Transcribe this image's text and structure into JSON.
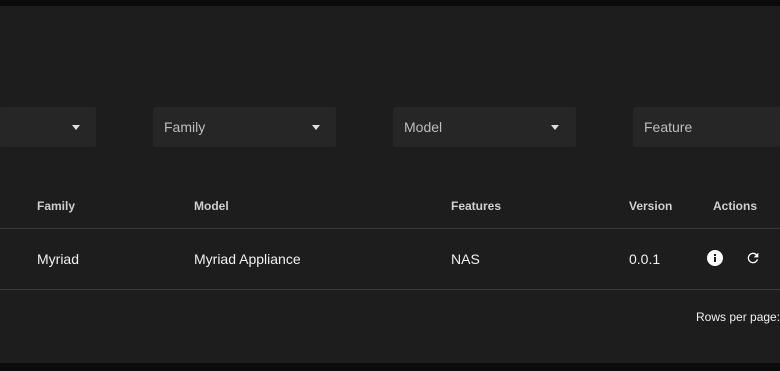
{
  "filters": {
    "first": {
      "label": ""
    },
    "family": {
      "label": "Family"
    },
    "model": {
      "label": "Model"
    },
    "feature": {
      "label": "Feature"
    }
  },
  "table": {
    "headers": [
      "Family",
      "Model",
      "Features",
      "Version",
      "Actions"
    ],
    "rows": [
      {
        "family": "Myriad",
        "model": "Myriad Appliance",
        "features": "NAS",
        "version": "0.0.1"
      }
    ]
  },
  "actions": {
    "icons": [
      "info-icon",
      "refresh-icon"
    ]
  },
  "footer": {
    "rows_per_page_label": "Rows per page:"
  }
}
